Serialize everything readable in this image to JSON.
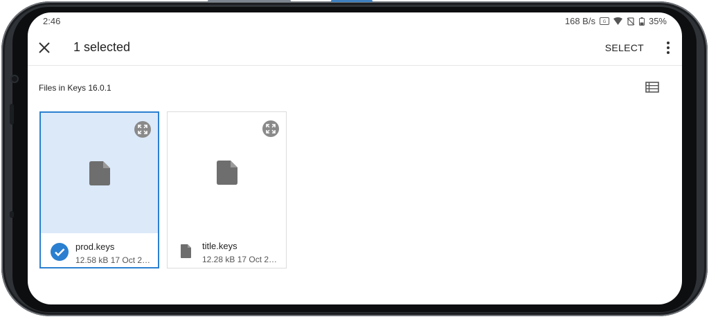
{
  "status": {
    "time": "2:46",
    "net_speed": "168 B/s",
    "battery": "35%"
  },
  "toolbar": {
    "title": "1 selected",
    "select_label": "SELECT"
  },
  "section": {
    "label": "Files in Keys 16.0.1"
  },
  "files": [
    {
      "name": "prod.keys",
      "meta": "12.58 kB 17 Oct 2…",
      "selected": true
    },
    {
      "name": "title.keys",
      "meta": "12.28 kB 17 Oct 2…",
      "selected": false
    }
  ],
  "colors": {
    "accent": "#2a7fd0",
    "selected_bg": "#dbe9f9",
    "icon_gray": "#6e6e6e"
  },
  "icons": {
    "close": "close-icon",
    "more": "more-vert-icon",
    "view_toggle": "list-view-icon",
    "expand": "fullscreen-icon",
    "file": "file-icon",
    "check": "check-circle-icon"
  }
}
